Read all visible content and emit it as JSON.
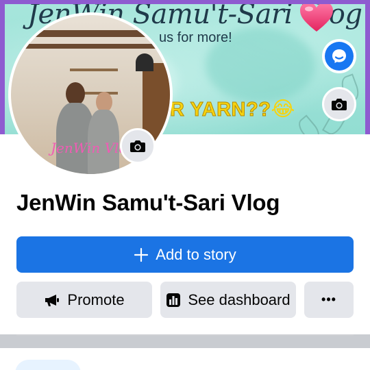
{
  "cover": {
    "title": "JenWin Samu't-Sari Vlog",
    "subtitle": "us for more!",
    "banner_text": "R YARN??",
    "emoji": "😂",
    "message_button_icon": "messenger-icon",
    "camera_button_icon": "camera-icon"
  },
  "profile": {
    "photo_watermark": "JenWin Vlog",
    "camera_button_icon": "camera-icon"
  },
  "page": {
    "name": "JenWin Samu't-Sari Vlog"
  },
  "actions": {
    "add_to_story": {
      "label": "Add to story",
      "icon": "plus-icon"
    },
    "promote": {
      "label": "Promote",
      "icon": "megaphone-icon"
    },
    "dashboard": {
      "label": "See dashboard",
      "icon": "dashboard-icon"
    },
    "more": {
      "label": "•••",
      "icon": "more-icon"
    }
  },
  "colors": {
    "primary": "#1b74e4",
    "secondary_bg": "#e4e6eb",
    "cover_frame": "#8e5bd0",
    "cover_bg": "#a7e6dc"
  }
}
